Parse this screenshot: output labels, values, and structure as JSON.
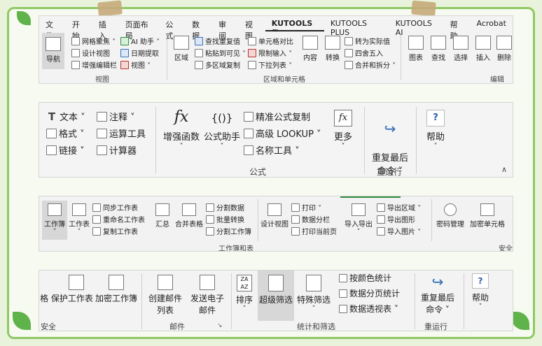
{
  "ribbon1": {
    "tabs": [
      "文件",
      "开始",
      "插入",
      "页面布局",
      "公式",
      "数据",
      "审阅",
      "视图",
      "KUTOOLS ™",
      "KUTOOLS PLUS",
      "KUTOOLS AI",
      "帮助",
      "Acrobat"
    ],
    "active_tab": "KUTOOLS ™",
    "nav_label": "导航",
    "view_items": [
      "网格聚焦 ˅",
      "设计视图",
      "增强编辑栏"
    ],
    "ai_items": [
      "AI 助手 ˅",
      "日期提取",
      "视图 ˅"
    ],
    "view_group": "视图",
    "range_big": "区域",
    "range_items": [
      "查找重复值",
      "粘贴到可见 ˅",
      "多区域复制"
    ],
    "cell_items": [
      "单元格对比",
      "限制输入 ˅",
      "下拉列表 ˅"
    ],
    "content_big": "内容",
    "convert_big": "转换",
    "convert_items": [
      "转为实际值",
      "四舍五入",
      "合并和拆分 ˅"
    ],
    "range_group": "区域和单元格",
    "chart_big": "图表",
    "find_big": "查找",
    "select_big": "选择",
    "insert_big": "插入",
    "delete_big": "删除",
    "edit_group": "编辑"
  },
  "ribbon2": {
    "text_items": [
      "文本 ˅",
      "格式 ˅",
      "链接 ˅"
    ],
    "note_items": [
      "注释 ˅",
      "运算工具",
      "计算器"
    ],
    "formula_fx": "fx",
    "enh_func": "增强函数",
    "formula_helper": "公式助手",
    "formula_helper_icon": "{()}",
    "formula_items": [
      "精准公式复制",
      "高级 LOOKUP ˅",
      "名称工具 ˅"
    ],
    "more": "更多",
    "formula_group": "公式",
    "rerun": "重复最后\n命令 ˅",
    "rerun_group": "重运行",
    "help": "帮助"
  },
  "ribbon3": {
    "workbook": "工作簿",
    "worksheet": "工作表",
    "sheet_items": [
      "同步工作表",
      "重命名工作表",
      "复制工作表"
    ],
    "summary": "汇总",
    "merge": "合并表格",
    "split_items": [
      "分割数据",
      "批量转换",
      "分割工作簿"
    ],
    "design_view": "设计视图",
    "print_items": [
      "打印 ˅",
      "数据分栏",
      "打印当前页"
    ],
    "export_import": "导入导出",
    "export_items": [
      "导出区域 ˅",
      "导出图形",
      "导入图片 ˅"
    ],
    "group": "工作簿和表",
    "password": "密码管理",
    "encrypt": "加密单元格",
    "security_group": "安全"
  },
  "ribbon4": {
    "protect_ws": "格 保护工作表",
    "encrypt_wb": "加密工作簿",
    "security_group": "安全",
    "create_mail": "创建邮件\n列表",
    "send_mail": "发送电子\n邮件",
    "mail_group": "邮件",
    "sort": "排序",
    "super_filter": "超级筛选",
    "special_filter": "特殊筛选",
    "stat_items": [
      "按颜色统计",
      "数据分页统计",
      "数据透视表 ˅"
    ],
    "stat_group": "统计和筛选",
    "rerun": "重复最后\n命令 ˅",
    "rerun_group": "重运行",
    "help": "帮助"
  }
}
